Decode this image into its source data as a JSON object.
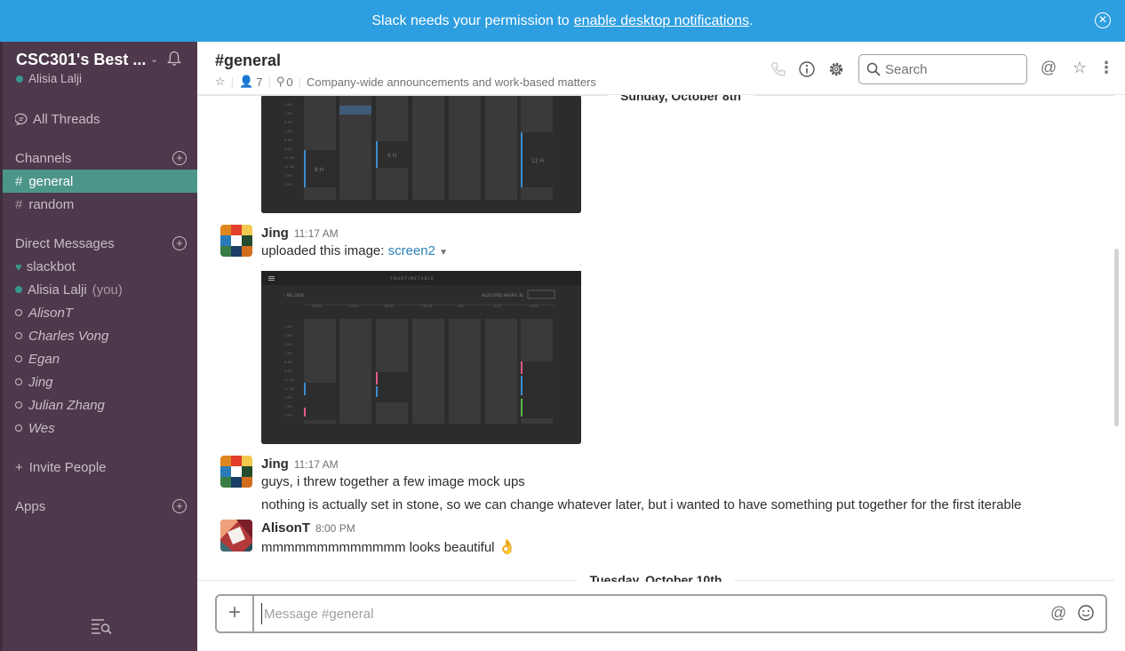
{
  "banner": {
    "text": "Slack needs your permission to",
    "link": "enable desktop notifications",
    "suffix": ".",
    "close_icon": "close-circle-icon"
  },
  "sidebar": {
    "team_name": "CSC301's Best ...",
    "user_name": "Alisia Lalji",
    "all_threads": "All Threads",
    "channels_header": "Channels",
    "channels": [
      {
        "name": "general",
        "active": true
      },
      {
        "name": "random",
        "active": false
      }
    ],
    "dm_header": "Direct Messages",
    "dms": [
      {
        "name": "slackbot",
        "status": "bot"
      },
      {
        "name": "Alisia Lalji",
        "status": "online",
        "you": "(you)"
      },
      {
        "name": "AlisonT",
        "status": "away"
      },
      {
        "name": "Charles Vong",
        "status": "away"
      },
      {
        "name": "Egan",
        "status": "away"
      },
      {
        "name": "Jing",
        "status": "away"
      },
      {
        "name": "Julian Zhang",
        "status": "away"
      },
      {
        "name": "Wes",
        "status": "away"
      }
    ],
    "invite": "Invite People",
    "apps": "Apps",
    "colors": {
      "bg": "#4d394b",
      "active": "#4c9689",
      "presence": "#38978d"
    }
  },
  "header": {
    "channel": "#general",
    "members": "7",
    "pins": "0",
    "purpose": "Company-wide announcements and work-based matters",
    "search_placeholder": "Search"
  },
  "messages": {
    "date1": "Sunday, October 8th",
    "date2": "Tuesday, October 10th",
    "m1": {
      "sender": "Jing",
      "time": "11:17 AM",
      "action": "uploaded this image:",
      "file": "screen2"
    },
    "m2": {
      "sender": "Jing",
      "time": "11:17 AM",
      "line1": "guys, i threw together a few image mock ups",
      "line2": "nothing is actually set in stone, so we can change whatever later, but i wanted to have something put together for the first iterable"
    },
    "m3": {
      "sender": "AlisonT",
      "time": "8:00 PM",
      "text": "mmmmmmmmmmmmm looks beautiful",
      "emoji": "👌"
    }
  },
  "composer": {
    "placeholder": "Message #general"
  }
}
